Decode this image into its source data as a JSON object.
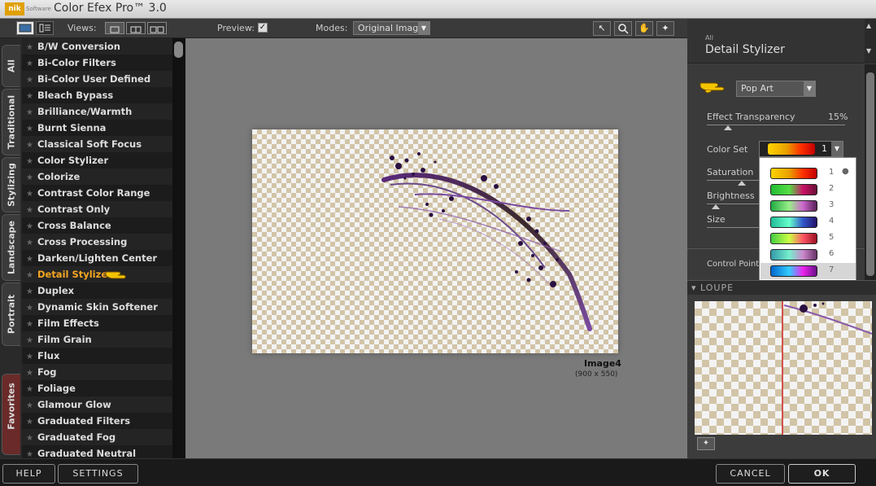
{
  "app": {
    "title": "Color Efex Pro™ 3.0",
    "logo": "nik",
    "logo_sub": "Software"
  },
  "toolbar": {
    "views_label": "Views:",
    "preview_label": "Preview:",
    "preview_checked": "✓",
    "modes_label": "Modes:",
    "modes_value": "Original Image"
  },
  "tabs": [
    "All",
    "Traditional",
    "Stylizing",
    "Landscape",
    "Portrait",
    "Favorites"
  ],
  "filters": [
    "B/W Conversion",
    "Bi-Color Filters",
    "Bi-Color User Defined",
    "Bleach Bypass",
    "Brilliance/Warmth",
    "Burnt Sienna",
    "Classical Soft Focus",
    "Color Stylizer",
    "Colorize",
    "Contrast Color Range",
    "Contrast Only",
    "Cross Balance",
    "Cross Processing",
    "Darken/Lighten Center",
    "Detail Stylizer",
    "Duplex",
    "Dynamic Skin Softener",
    "Film Effects",
    "Film Grain",
    "Flux",
    "Fog",
    "Foliage",
    "Glamour Glow",
    "Graduated Filters",
    "Graduated Fog",
    "Graduated Neutral Density"
  ],
  "active_filter": "Detail Stylizer",
  "image": {
    "name": "Image4",
    "size": "(900 x 550)"
  },
  "panel": {
    "category": "All",
    "title": "Detail Stylizer",
    "preset": "Pop Art",
    "effect_transparency_label": "Effect Transparency",
    "effect_transparency_value": "15%",
    "color_set_label": "Color Set",
    "color_set_value": "1",
    "saturation_label": "Saturation",
    "brightness_label": "Brightness",
    "size_label": "Size",
    "control_points_label": "Control Points"
  },
  "color_sets": [
    {
      "label": "1",
      "selected_mark": "●",
      "colors": [
        "#ffd400",
        "#e8a000",
        "#ff3000",
        "#c00000"
      ]
    },
    {
      "label": "2",
      "colors": [
        "#22bb33",
        "#55dd44",
        "#cc1166",
        "#661133"
      ]
    },
    {
      "label": "3",
      "colors": [
        "#22aa44",
        "#99ee88",
        "#cc66cc",
        "#552255"
      ]
    },
    {
      "label": "4",
      "colors": [
        "#22bb99",
        "#66ffcc",
        "#3355cc",
        "#221166"
      ]
    },
    {
      "label": "5",
      "colors": [
        "#44cc44",
        "#ccff44",
        "#ff5566",
        "#991122"
      ]
    },
    {
      "label": "6",
      "colors": [
        "#3399aa",
        "#77eecc",
        "#cc88cc",
        "#663366"
      ]
    },
    {
      "label": "7",
      "colors": [
        "#0066cc",
        "#33ccff",
        "#ee22ee",
        "#661188"
      ]
    }
  ],
  "loupe": {
    "label": "LOUPE"
  },
  "buttons": {
    "help": "HELP",
    "settings": "SETTINGS",
    "cancel": "CANCEL",
    "ok": "OK"
  }
}
